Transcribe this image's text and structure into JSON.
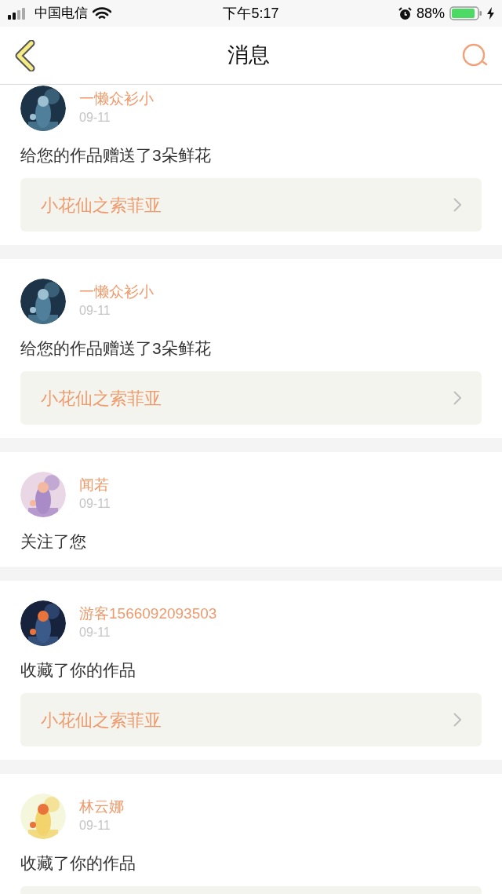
{
  "status_bar": {
    "carrier": "中国电信",
    "time": "下午5:17",
    "battery": "88%"
  },
  "nav": {
    "title": "消息"
  },
  "messages": [
    {
      "kind": "picture",
      "name": "一懒众衫小",
      "date": "09-11",
      "text": "给您的作品赠送了3朵鲜花",
      "work_box": true,
      "work": "小花仙之索菲亚"
    },
    {
      "kind": "picture",
      "name": "一懒众衫小",
      "date": "09-11",
      "text": "给您的作品赠送了3朵鲜花",
      "work_box": true,
      "work": "小花仙之索菲亚"
    },
    {
      "kind": "picture",
      "name": "闻若",
      "date": "09-11",
      "text": "关注了您",
      "work_box": false
    },
    {
      "kind": "picture",
      "name": "游客1566092093503",
      "date": "09-11",
      "text": "收藏了你的作品",
      "work_box": true,
      "work": "小花仙之索菲亚"
    },
    {
      "kind": "picture",
      "name": "林云娜",
      "date": "09-11",
      "text": "收藏了你的作品",
      "work_box": true
    }
  ]
}
